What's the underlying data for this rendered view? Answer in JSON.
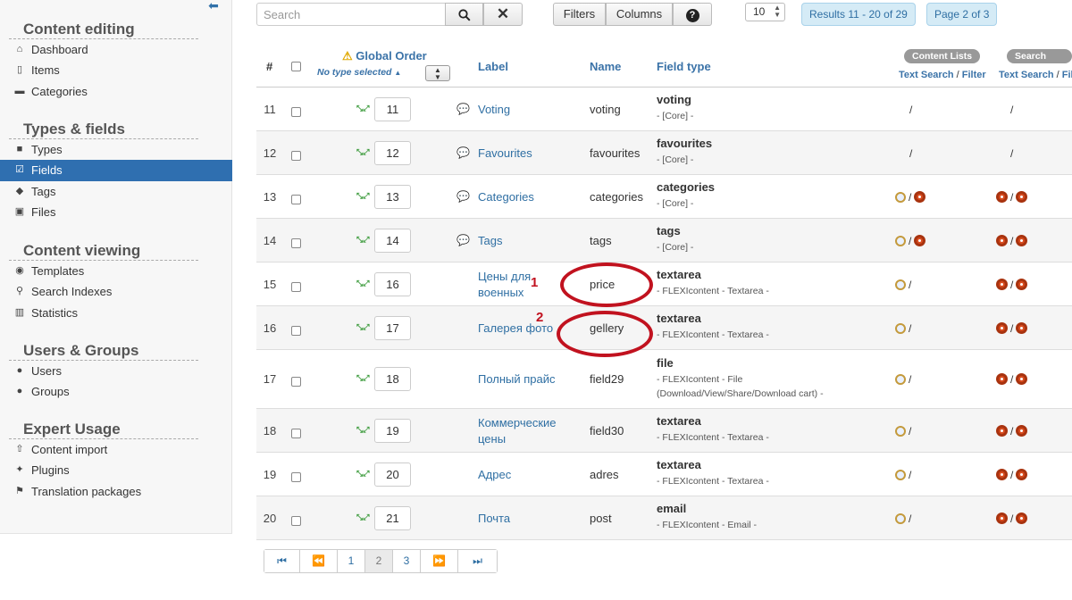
{
  "sidebar": {
    "sections": [
      {
        "title": "Content editing",
        "items": [
          {
            "label": "Dashboard",
            "icon": "home-icon"
          },
          {
            "label": "Items",
            "icon": "document-icon"
          },
          {
            "label": "Categories",
            "icon": "folder-icon"
          }
        ]
      },
      {
        "title": "Types & fields",
        "items": [
          {
            "label": "Types",
            "icon": "briefcase-icon"
          },
          {
            "label": "Fields",
            "icon": "checkbox-list-icon",
            "active": true
          },
          {
            "label": "Tags",
            "icon": "tags-icon"
          },
          {
            "label": "Files",
            "icon": "image-icon"
          }
        ]
      },
      {
        "title": "Content viewing",
        "items": [
          {
            "label": "Templates",
            "icon": "eye-icon"
          },
          {
            "label": "Search Indexes",
            "icon": "search-icon"
          },
          {
            "label": "Statistics",
            "icon": "bar-chart-icon"
          }
        ]
      },
      {
        "title": "Users & Groups",
        "items": [
          {
            "label": "Users",
            "icon": "user-icon"
          },
          {
            "label": "Groups",
            "icon": "group-icon"
          }
        ]
      },
      {
        "title": "Expert Usage",
        "items": [
          {
            "label": "Content import",
            "icon": "upload-icon"
          },
          {
            "label": "Plugins",
            "icon": "plug-icon"
          },
          {
            "label": "Translation packages",
            "icon": "flag-icon"
          }
        ]
      }
    ]
  },
  "toolbar": {
    "search_placeholder": "Search",
    "filters_label": "Filters",
    "columns_label": "Columns",
    "help_label": "?",
    "limit_value": "10",
    "results_text": "Results 11 - 20 of 29",
    "page_text": "Page 2 of 3"
  },
  "table": {
    "headers": {
      "num": "#",
      "global_order": "Global Order",
      "no_type_selected": "No type selected",
      "label": "Label",
      "name": "Name",
      "field_type": "Field type",
      "content_lists_badge": "Content Lists",
      "content_lists_sub1": "Text Search",
      "content_lists_sub2": "Filter",
      "search_view_badge": "Search view",
      "search_view_sub1": "Text Search",
      "search_view_sub2": "Filter",
      "slash": "/"
    },
    "rows": [
      {
        "num": "11",
        "order": "11",
        "label": "Voting",
        "name": "voting",
        "type": "voting",
        "type_desc": "- [Core] -",
        "core": true,
        "cl": "slash",
        "sv": "slash"
      },
      {
        "num": "12",
        "order": "12",
        "label": "Favourites",
        "name": "favourites",
        "type": "favourites",
        "type_desc": "- [Core] -",
        "core": true,
        "cl": "slash",
        "sv": "slash"
      },
      {
        "num": "13",
        "order": "13",
        "label": "Categories",
        "name": "categories",
        "type": "categories",
        "type_desc": "- [Core] -",
        "core": true,
        "cl": "mag-dot",
        "sv": "dot-dot"
      },
      {
        "num": "14",
        "order": "14",
        "label": "Tags",
        "name": "tags",
        "type": "tags",
        "type_desc": "- [Core] -",
        "core": true,
        "cl": "mag-dot",
        "sv": "dot-dot"
      },
      {
        "num": "15",
        "order": "16",
        "label": "Цены для военных",
        "name": "price",
        "type": "textarea",
        "type_desc": "- FLEXIcontent - Textarea -",
        "core": false,
        "cl": "mag",
        "sv": "dot-dot"
      },
      {
        "num": "16",
        "order": "17",
        "label": "Галерея фото",
        "name": "gellery",
        "type": "textarea",
        "type_desc": "- FLEXIcontent - Textarea -",
        "core": false,
        "cl": "mag",
        "sv": "dot-dot"
      },
      {
        "num": "17",
        "order": "18",
        "label": "Полный прайс",
        "name": "field29",
        "type": "file",
        "type_desc": "- FLEXIcontent - File (Download/View/Share/Download cart) -",
        "core": false,
        "cl": "mag",
        "sv": "dot-dot"
      },
      {
        "num": "18",
        "order": "19",
        "label": "Коммерческие цены",
        "name": "field30",
        "type": "textarea",
        "type_desc": "- FLEXIcontent - Textarea -",
        "core": false,
        "cl": "mag",
        "sv": "dot-dot"
      },
      {
        "num": "19",
        "order": "20",
        "label": "Адрес",
        "name": "adres",
        "type": "textarea",
        "type_desc": "- FLEXIcontent - Textarea -",
        "core": false,
        "cl": "mag",
        "sv": "dot-dot"
      },
      {
        "num": "20",
        "order": "21",
        "label": "Почта",
        "name": "post",
        "type": "email",
        "type_desc": "- FLEXIcontent - Email -",
        "core": false,
        "cl": "mag",
        "sv": "dot-dot"
      }
    ]
  },
  "annotations": {
    "mark1": "1",
    "mark2": "2",
    "color": "#c1121f"
  },
  "pagination": {
    "pages": [
      "1",
      "2",
      "3"
    ],
    "current": "2"
  }
}
